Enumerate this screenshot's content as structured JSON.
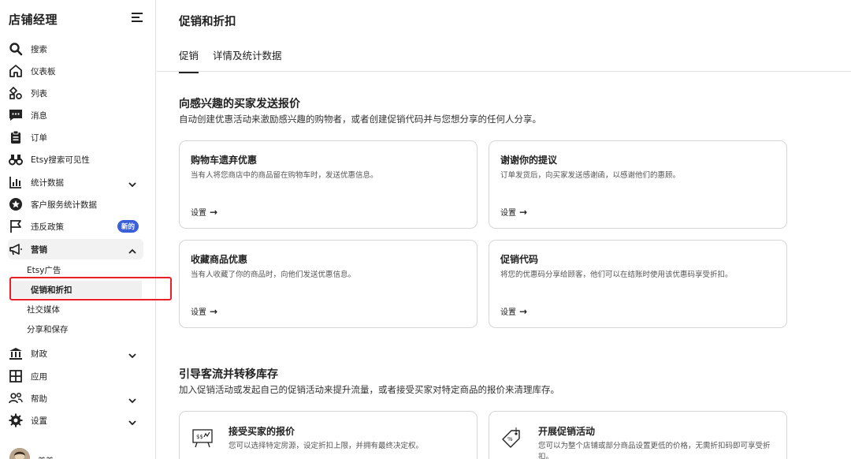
{
  "sidebar": {
    "title": "店铺经理",
    "items": [
      {
        "label": "搜索",
        "icon": "search-icon"
      },
      {
        "label": "仪表板",
        "icon": "home-icon"
      },
      {
        "label": "列表",
        "icon": "listings-icon"
      },
      {
        "label": "消息",
        "icon": "message-icon"
      },
      {
        "label": "订单",
        "icon": "orders-icon"
      },
      {
        "label": "Etsy搜索可见性",
        "icon": "binoculars-icon"
      },
      {
        "label": "统计数据",
        "icon": "stats-icon"
      },
      {
        "label": "客户服务统计数据",
        "icon": "star-badge-icon"
      },
      {
        "label": "违反政策",
        "icon": "flag-icon",
        "badge": "新的"
      },
      {
        "label": "营销",
        "icon": "megaphone-icon"
      },
      {
        "label": "财政",
        "icon": "bank-icon"
      },
      {
        "label": "应用",
        "icon": "apps-icon"
      },
      {
        "label": "帮助",
        "icon": "help-icon"
      },
      {
        "label": "设置",
        "icon": "gear-icon"
      }
    ],
    "marketing_sub": [
      "Etsy广告",
      "促销和折扣",
      "社交媒体",
      "分享和保存"
    ],
    "user_name": "美美"
  },
  "main": {
    "title": "促销和折扣",
    "tabs": [
      "促销",
      "详情及统计数据"
    ],
    "section1": {
      "title": "向感兴趣的买家发送报价",
      "desc": "自动创建优惠活动来激励感兴趣的购物者，或者创建促销代码并与您想分享的任何人分享。",
      "cards": [
        {
          "title": "购物车遗弃优惠",
          "desc": "当有人将您商店中的商品留在购物车时，发送优惠信息。",
          "link": "设置"
        },
        {
          "title": "谢谢你的提议",
          "desc": "订单发货后，向买家发送感谢函，以感谢他们的惠顾。",
          "link": "设置"
        },
        {
          "title": "收藏商品优惠",
          "desc": "当有人收藏了你的商品时，向他们发送优惠信息。",
          "link": "设置"
        },
        {
          "title": "促销代码",
          "desc": "将您的优惠码分享给顾客，他们可以在结账时使用该优惠码享受折扣。",
          "link": "设置"
        }
      ]
    },
    "section2": {
      "title": "引导客流并转移库存",
      "desc": "加入促销活动或发起自己的促销活动来提升流量，或者接受买家对特定商品的报价来清理库存。",
      "cards": [
        {
          "title": "接受买家的报价",
          "desc": "您可以选择特定房源，设定折扣上限，并拥有最终决定权。",
          "icon": "offer-board-icon"
        },
        {
          "title": "开展促销活动",
          "desc": "您可以为整个店铺或部分商品设置更低的价格，无需折扣码即可享受折扣。",
          "icon": "price-tag-icon"
        }
      ]
    }
  },
  "colors": {
    "badge": "#3b5fd9",
    "highlight_box": "#e8202a",
    "active_bg": "#f2f2f2"
  }
}
